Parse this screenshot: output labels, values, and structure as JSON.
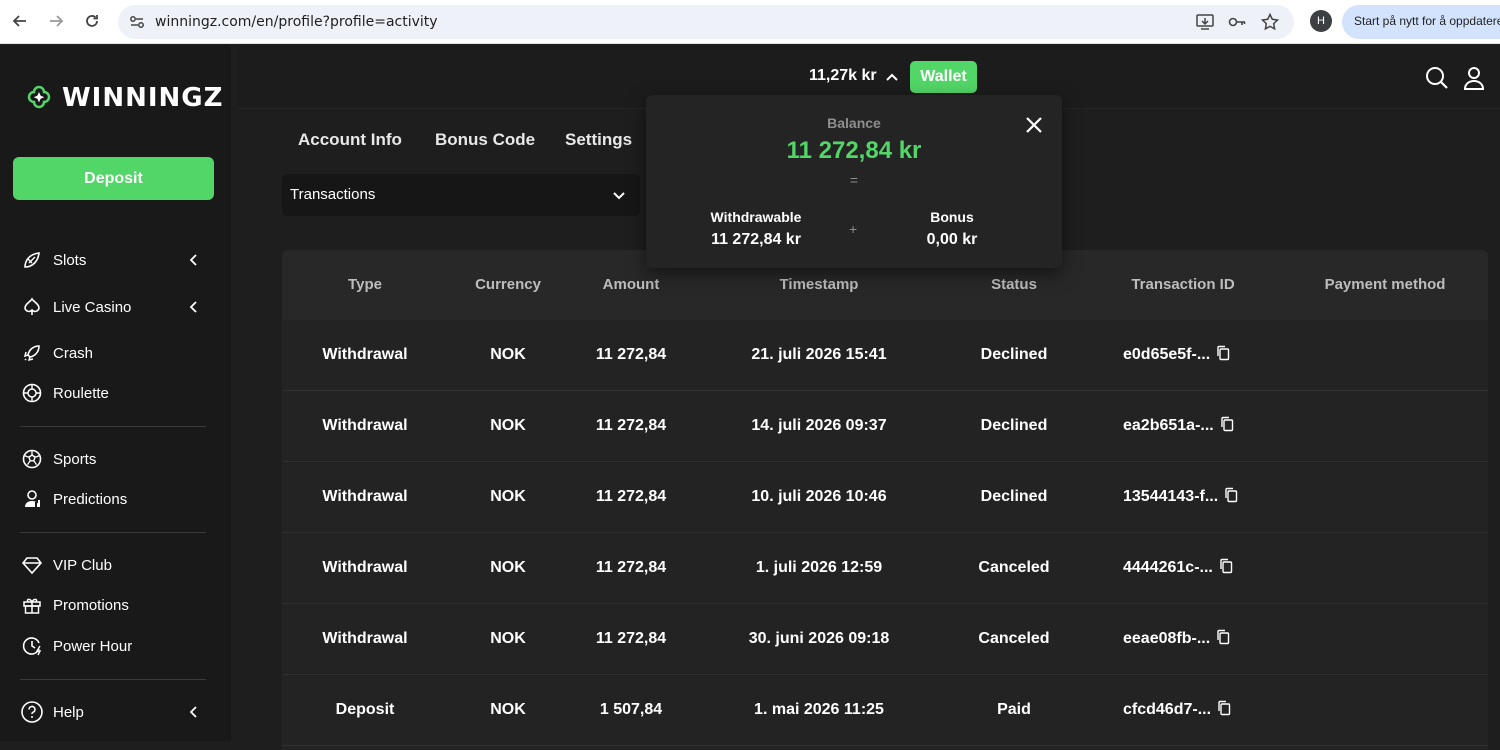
{
  "browser": {
    "url": "winningz.com/en/profile?profile=activity",
    "profile_initial": "H",
    "update_label": "Start på nytt for å oppdatere"
  },
  "sidebar": {
    "logo_text": "WINNINGZ",
    "deposit_label": "Deposit",
    "items": [
      {
        "label": "Slots",
        "icon": "slot-icon",
        "has_chevron": true
      },
      {
        "label": "Live Casino",
        "icon": "spade-icon",
        "has_chevron": true
      },
      {
        "label": "Crash",
        "icon": "rocket-icon",
        "has_chevron": false
      },
      {
        "label": "Roulette",
        "icon": "roulette-icon",
        "has_chevron": false
      },
      {
        "label": "Sports",
        "icon": "soccer-ball-icon",
        "has_chevron": false
      },
      {
        "label": "Predictions",
        "icon": "predictions-icon",
        "has_chevron": false
      },
      {
        "label": "VIP Club",
        "icon": "diamond-icon",
        "has_chevron": false
      },
      {
        "label": "Promotions",
        "icon": "gift-icon",
        "has_chevron": false
      },
      {
        "label": "Power Hour",
        "icon": "clock-icon",
        "has_chevron": false
      },
      {
        "label": "Help",
        "icon": "help-icon",
        "has_chevron": true
      }
    ]
  },
  "header": {
    "balance_short": "11,27k kr",
    "wallet_label": "Wallet"
  },
  "tabs": [
    "Account Info",
    "Bonus Code",
    "Settings"
  ],
  "filter": {
    "selected": "Transactions"
  },
  "wallet_popover": {
    "balance_label": "Balance",
    "balance_value": "11 272,84 kr",
    "equals": "=",
    "plus": "+",
    "withdrawable_label": "Withdrawable",
    "withdrawable_value": "11 272,84 kr",
    "bonus_label": "Bonus",
    "bonus_value": "0,00 kr"
  },
  "table": {
    "columns": [
      "Type",
      "Currency",
      "Amount",
      "Timestamp",
      "Status",
      "Transaction ID",
      "Payment method"
    ],
    "rows": [
      {
        "type": "Withdrawal",
        "currency": "NOK",
        "amount": "11 272,84",
        "timestamp": "21. juli 2026 15:41",
        "status": "Declined",
        "txid": "e0d65e5f-...",
        "payment": ""
      },
      {
        "type": "Withdrawal",
        "currency": "NOK",
        "amount": "11 272,84",
        "timestamp": "14. juli 2026 09:37",
        "status": "Declined",
        "txid": "ea2b651a-...",
        "payment": ""
      },
      {
        "type": "Withdrawal",
        "currency": "NOK",
        "amount": "11 272,84",
        "timestamp": "10. juli 2026 10:46",
        "status": "Declined",
        "txid": "13544143-f...",
        "payment": ""
      },
      {
        "type": "Withdrawal",
        "currency": "NOK",
        "amount": "11 272,84",
        "timestamp": "1. juli 2026 12:59",
        "status": "Canceled",
        "txid": "4444261c-...",
        "payment": ""
      },
      {
        "type": "Withdrawal",
        "currency": "NOK",
        "amount": "11 272,84",
        "timestamp": "30. juni 2026 09:18",
        "status": "Canceled",
        "txid": "eeae08fb-...",
        "payment": ""
      },
      {
        "type": "Deposit",
        "currency": "NOK",
        "amount": "1 507,84",
        "timestamp": "1. mai 2026 11:25",
        "status": "Paid",
        "txid": "cfcd46d7-...",
        "payment": ""
      }
    ]
  },
  "colors": {
    "accent": "#52d667",
    "background": "#1e1e1e",
    "sidebar": "#191919"
  }
}
